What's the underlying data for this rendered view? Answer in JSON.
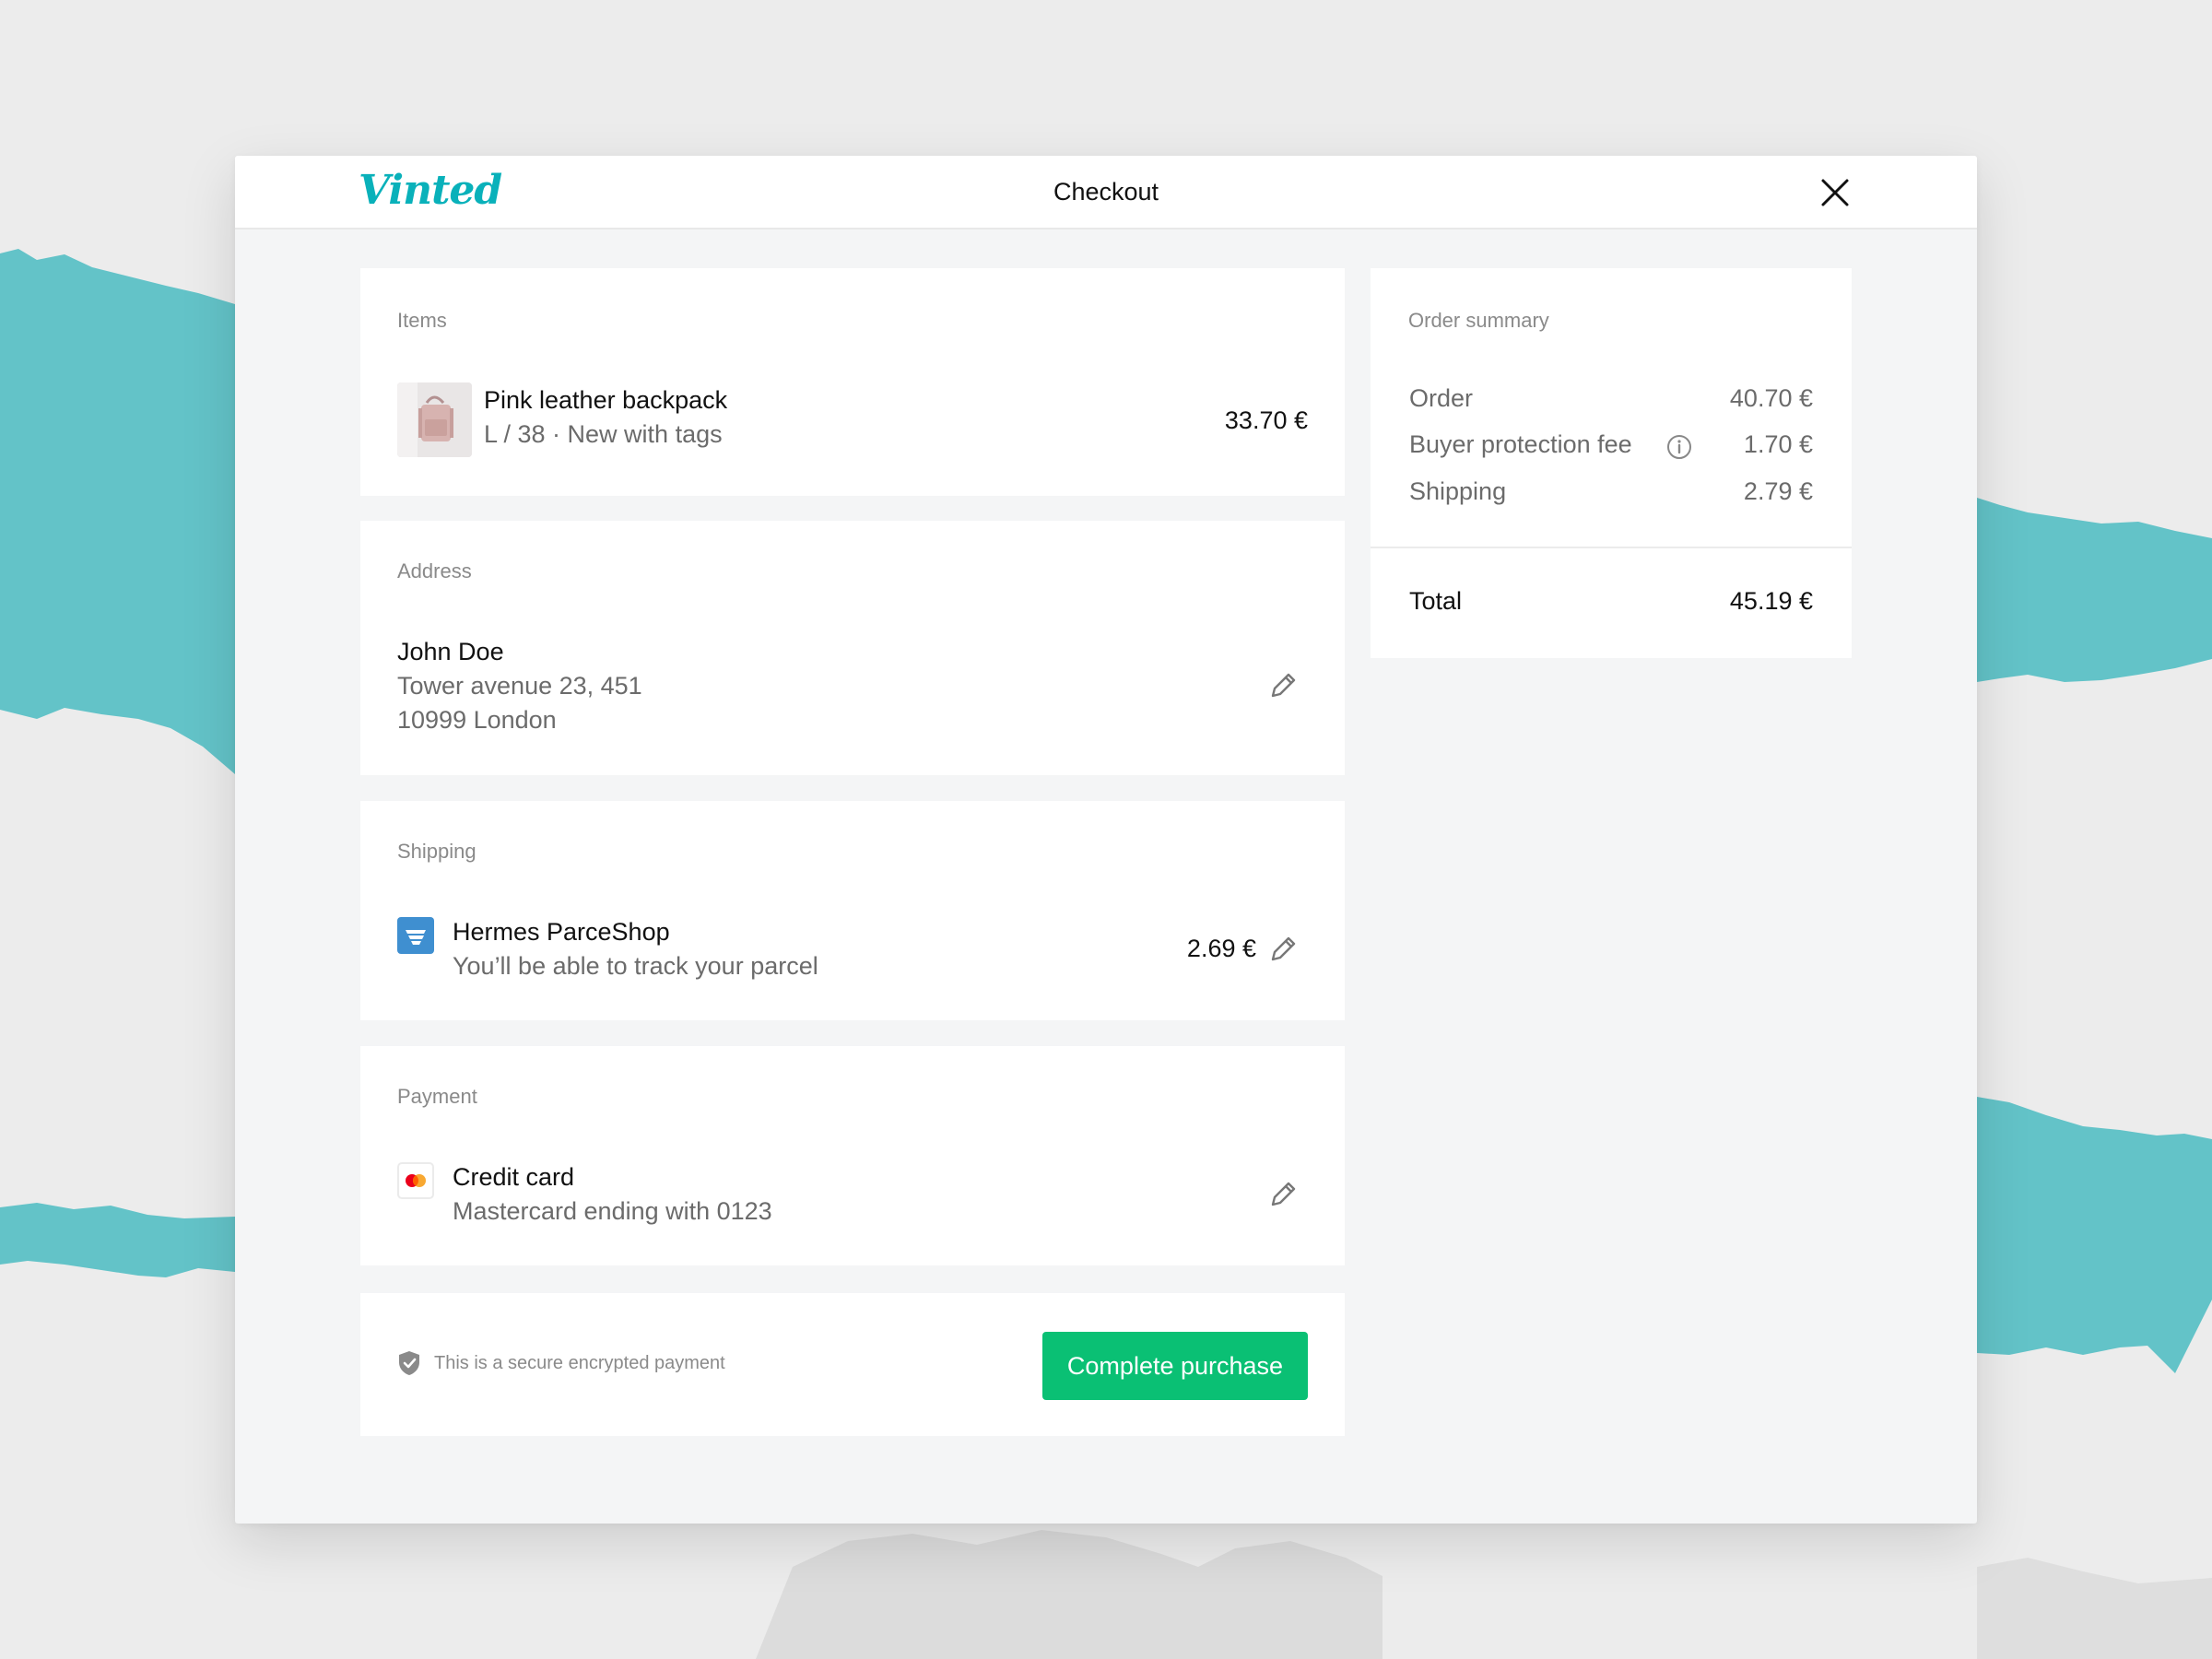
{
  "app": {
    "brand": "Vinted",
    "title": "Checkout"
  },
  "colors": {
    "brand": "#09b1ba",
    "primary_button": "#0ac074",
    "background_band": "#63c3c8"
  },
  "items": {
    "label": "Items",
    "product": {
      "name": "Pink leather backpack",
      "details": "L / 38 · New with tags",
      "price": "33.70 €"
    }
  },
  "address": {
    "label": "Address",
    "name": "John Doe",
    "line1": "Tower avenue 23, 451",
    "line2": "10999 London"
  },
  "shipping": {
    "label": "Shipping",
    "carrier": "Hermes ParceShop",
    "note": "You’ll be able to track your parcel",
    "price": "2.69 €"
  },
  "payment": {
    "label": "Payment",
    "method": "Credit card",
    "detail": "Mastercard ending with 0123"
  },
  "footer": {
    "secure_text": "This is a secure encrypted payment",
    "cta_label": "Complete purchase"
  },
  "summary": {
    "label": "Order summary",
    "rows": [
      {
        "label": "Order",
        "value": "40.70 €"
      },
      {
        "label": "Buyer protection fee",
        "value": "1.70 €"
      },
      {
        "label": "Shipping",
        "value": "2.79 €"
      }
    ],
    "total_label": "Total",
    "total_value": "45.19 €"
  },
  "icons": [
    "close-icon",
    "edit-icon",
    "info-icon",
    "shield-check-icon",
    "hermes-logo-icon",
    "mastercard-icon"
  ]
}
